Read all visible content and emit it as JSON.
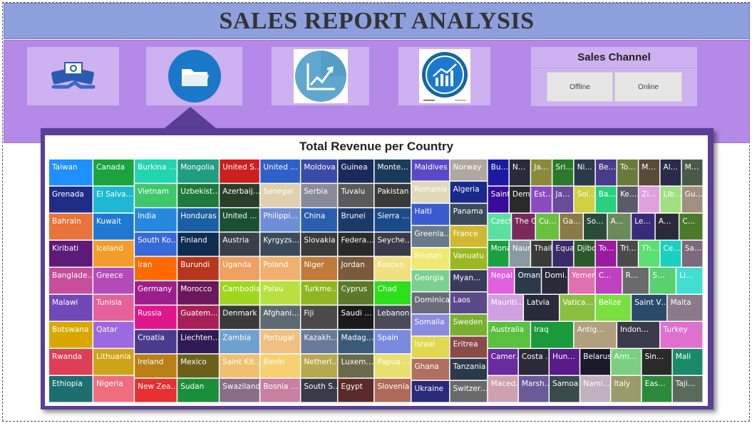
{
  "header": {
    "title": "SALES REPORT ANALYSIS"
  },
  "nav": {
    "tiles": [
      {
        "icon": "handshake-money-icon"
      },
      {
        "icon": "folder-icon"
      },
      {
        "icon": "line-chart-icon"
      },
      {
        "icon": "bar-trend-chart-icon"
      }
    ],
    "selected_index": 1
  },
  "sales_channel": {
    "title": "Sales Channel",
    "options": [
      "Offline",
      "Online"
    ]
  },
  "colors": {
    "title_bar": "#8e9fdd",
    "nav_band": "#b589e8",
    "tile": "#ceb1f0",
    "chart_frame": "#5b3f96"
  },
  "chart_data": {
    "type": "treemap",
    "title": "Total Revenue per Country",
    "columns": [
      {
        "weight": 62,
        "cells": [
          [
            "Taiwan",
            "#1e90ff"
          ],
          [
            "Grenada",
            "#1f2d86"
          ],
          [
            "Bahrain",
            "#e8743b"
          ],
          [
            "Kiribati",
            "#5e1a7a"
          ],
          [
            "Banglade…",
            "#c64e9a"
          ],
          [
            "Malawi",
            "#7048b8"
          ],
          [
            "Botswana",
            "#d9a800"
          ],
          [
            "Rwanda",
            "#dd3f56"
          ],
          [
            "Ethiopia",
            "#1c6f6f"
          ]
        ]
      },
      {
        "weight": 58,
        "cells": [
          [
            "Canada",
            "#1aa33f"
          ],
          [
            "El Salva…",
            "#1fb8d3"
          ],
          [
            "Kuwait",
            "#1f78d1"
          ],
          [
            "Iceland",
            "#f39c2a"
          ],
          [
            "Greece",
            "#b44cb8"
          ],
          [
            "Tunisia",
            "#e6609a"
          ],
          [
            "Qatar",
            "#9b69e0"
          ],
          [
            "Lithuania",
            "#cfa318"
          ],
          [
            "Nigeria",
            "#f06d7e"
          ]
        ]
      },
      {
        "weight": 60,
        "cells": [
          [
            "Burkina …",
            "#23d4b0"
          ],
          [
            "Vietnam",
            "#3fc86b"
          ],
          [
            "India",
            "#2687e0"
          ],
          [
            "South Ko…",
            "#3869d8"
          ],
          [
            "Iran",
            "#ff6a00"
          ],
          [
            "Germany",
            "#9c1e8a"
          ],
          [
            "Russia",
            "#e0168a"
          ],
          [
            "Croatia",
            "#4b3a8e"
          ],
          [
            "Ireland",
            "#b77f15"
          ],
          [
            "New Zea…",
            "#e83030"
          ]
        ]
      },
      {
        "weight": 59,
        "cells": [
          [
            "Mongolia",
            "#1f9e82"
          ],
          [
            "Uzbekist…",
            "#1e7a3a"
          ],
          [
            "Honduras",
            "#1a5fa3"
          ],
          [
            "Finland",
            "#0e2c4f"
          ],
          [
            "Burundi",
            "#b7361b"
          ],
          [
            "Morocco",
            "#6a1859"
          ],
          [
            "Guatem…",
            "#a81e57"
          ],
          [
            "Liechten…",
            "#2e1a55"
          ],
          [
            "Mexico",
            "#6b5f1a"
          ],
          [
            "Sudan",
            "#1a8f3a"
          ]
        ]
      },
      {
        "weight": 57,
        "cells": [
          [
            "United S…",
            "#cc1f1f"
          ],
          [
            "Azerbaij…",
            "#2a3f2a"
          ],
          [
            "United …",
            "#1a5030"
          ],
          [
            "Austria",
            "#3a3f4a"
          ],
          [
            "Uganda",
            "#f0a060"
          ],
          [
            "Cambodia",
            "#9fd61f"
          ],
          [
            "Denmark",
            "#3a3a3a"
          ],
          [
            "Zambia",
            "#6fa0d0"
          ],
          [
            "Saint Kit…",
            "#f0c070"
          ],
          [
            "Swaziland",
            "#8a6e88"
          ]
        ]
      },
      {
        "weight": 57,
        "cells": [
          [
            "United …",
            "#2f5fc8"
          ],
          [
            "Senegal",
            "#e0d0b0"
          ],
          [
            "Philippi…",
            "#6f8ed8"
          ],
          [
            "Kyrgyzs…",
            "#3a4a5a"
          ],
          [
            "Poland",
            "#f0b070"
          ],
          [
            "Palau",
            "#b8e040"
          ],
          [
            "Afghani…",
            "#5a6a70"
          ],
          [
            "Portugal",
            "#f0c080"
          ],
          [
            "Benin",
            "#f7d070"
          ],
          [
            "Bosnia …",
            "#c87fa0"
          ]
        ]
      },
      {
        "weight": 52,
        "cells": [
          [
            "Moldova",
            "#3a4aa8"
          ],
          [
            "Serbia",
            "#8a8a9a"
          ],
          [
            "China",
            "#2a5fb0"
          ],
          [
            "Slovakia",
            "#3a3a3a"
          ],
          [
            "Niger",
            "#c07a3a"
          ],
          [
            "Turkme…",
            "#8fb820"
          ],
          [
            "Fiji",
            "#4a4a4a"
          ],
          [
            "Kazakh…",
            "#6a7a9a"
          ],
          [
            "Netherl…",
            "#b8a850"
          ],
          [
            "South S…",
            "#3a3a4a"
          ]
        ]
      },
      {
        "weight": 51,
        "cells": [
          [
            "Guinea",
            "#1a2a5a"
          ],
          [
            "Tuvalu",
            "#5a5a5a"
          ],
          [
            "Brunei",
            "#1a3a6a"
          ],
          [
            "Federa…",
            "#2a2a2a"
          ],
          [
            "Jordan",
            "#7a5a3a"
          ],
          [
            "Cyprus",
            "#5a7a2a"
          ],
          [
            "Saudi …",
            "#1a1a1a"
          ],
          [
            "Madag…",
            "#3a5a7a"
          ],
          [
            "Luxem…",
            "#6a6a4a"
          ],
          [
            "Egypt",
            "#5a2a2a"
          ]
        ]
      },
      {
        "weight": 52,
        "cells": [
          [
            "Monte…",
            "#1a3a5a"
          ],
          [
            "Pakistan",
            "#3a3a3a"
          ],
          [
            "Sierra …",
            "#1a4a8a"
          ],
          [
            "Seyche…",
            "#3a3a4a"
          ],
          [
            "Kosovo",
            "#f0e080"
          ],
          [
            "Chad",
            "#2ee01a"
          ],
          [
            "Lebanon",
            "#4a4a5a"
          ],
          [
            "Spain",
            "#7a8ae0"
          ],
          [
            "Papua …",
            "#e8e070"
          ],
          [
            "Slovenia",
            "#b06a5a"
          ]
        ]
      },
      {
        "weight": 54,
        "cells": [
          [
            "Maldives",
            "#5a48c8"
          ],
          [
            "Romania",
            "#e0d8b8"
          ],
          [
            "Haiti",
            "#3a5ad0"
          ],
          [
            "Greenla…",
            "#6a7a8a"
          ],
          [
            "Bhutan",
            "#f0e870"
          ],
          [
            "Georgia",
            "#7ad090"
          ],
          [
            "Dominica",
            "#6a6a7a"
          ],
          [
            "Somalia",
            "#8a8ae0"
          ],
          [
            "Israel",
            "#e0d850"
          ],
          [
            "Ghana",
            "#b07060"
          ],
          [
            "Ukraine",
            "#2a2a7a"
          ]
        ]
      },
      {
        "weight": 53,
        "cells": [
          [
            "Norway",
            "#b0a8a0"
          ],
          [
            "Algeria",
            "#1a2a8a"
          ],
          [
            "Panama",
            "#3a4a5a"
          ],
          [
            "France",
            "#d0b830"
          ],
          [
            "Vanuatu",
            "#9ab820"
          ],
          [
            "Myan…",
            "#3a3a5a"
          ],
          [
            "Laos",
            "#5a4a8a"
          ],
          [
            "Sweden",
            "#7ab030"
          ],
          [
            "Eritrea",
            "#8a4a4a"
          ],
          [
            "Tanzania",
            "#2a3a4a"
          ],
          [
            "Switzer…",
            "#6a6a6a"
          ]
        ]
      },
      {
        "weight": 302,
        "cells": []
      }
    ],
    "rest": [
      [
        "Bu…",
        "#1a1aa0"
      ],
      [
        "N…",
        "#2a2a3a"
      ],
      [
        "Ja…",
        "#8a8a3a"
      ],
      [
        "Sri…",
        "#2a7a2a"
      ],
      [
        "Ni…",
        "#2a3a4a"
      ],
      [
        "Be…",
        "#4a3a8a"
      ],
      [
        "To…",
        "#6a7a3a"
      ],
      [
        "M…",
        "#5a4a3a"
      ],
      [
        "Al…",
        "#2a2a4a"
      ],
      [
        "M…",
        "#4a5a4a"
      ],
      [
        "Saint L…",
        "#3a0a9a"
      ],
      [
        "Democ…",
        "#2a2a2a"
      ],
      [
        "Est…",
        "#8a4ac0"
      ],
      [
        "Ja…",
        "#6a4a9a"
      ],
      [
        "Sol…",
        "#d0d040"
      ],
      [
        "Ba…",
        "#2ad080"
      ],
      [
        "Ke…",
        "#5a5a6a"
      ],
      [
        "Zi…",
        "#e0a0e0"
      ],
      [
        "Lib…",
        "#a0e080"
      ],
      [
        "Gu…",
        "#a09080"
      ],
      [
        "Czech …",
        "#5ae0a0"
      ],
      [
        "The G…",
        "#7a2a5a"
      ],
      [
        "Cu…",
        "#6ac040"
      ],
      [
        "Ga…",
        "#8a7a4a"
      ],
      [
        "So…",
        "#2a4a3a"
      ],
      [
        "A…",
        "#6a8a5a"
      ],
      [
        "Le…",
        "#3a2a7a"
      ],
      [
        "A…",
        "#2a2a3a"
      ],
      [
        "C…",
        "#4a7a2a"
      ],
      [
        "Monaco",
        "#1aa040"
      ],
      [
        "Nauru",
        "#8a9aa0"
      ],
      [
        "Thailand",
        "#3a3a3a"
      ],
      [
        "Equat…",
        "#3a2a6a"
      ],
      [
        "Djibouti",
        "#2a5a2a"
      ],
      [
        "To…",
        "#9a1aa0"
      ],
      [
        "Tri…",
        "#4a4a4a"
      ],
      [
        "Th…",
        "#5ae070"
      ],
      [
        "Ce…",
        "#1ad0c0"
      ],
      [
        "Sa…",
        "#7a6a7a"
      ],
      [
        "Nepal",
        "#e060e0"
      ],
      [
        "Oman",
        "#2a3a4a"
      ],
      [
        "Domi…",
        "#2a2a3a"
      ],
      [
        "Yemen",
        "#e070b0"
      ],
      [
        "C…",
        "#c040c0"
      ],
      [
        "R…",
        "#6a6a6a"
      ],
      [
        "S…",
        "#5ad070"
      ],
      [
        "Li…",
        "#40e0d0"
      ],
      [
        "Mauriti…",
        "#d0a0e0"
      ],
      [
        "Latvia",
        "#2a2a3a"
      ],
      [
        "Vatica…",
        "#8ac040"
      ],
      [
        "Belize",
        "#7ae040"
      ],
      [
        "Saint V…",
        "#2a4a6a"
      ],
      [
        "Malta",
        "#8a7a8a"
      ],
      [
        "Australia",
        "#5ac040"
      ],
      [
        "Iraq",
        "#1a9a3a"
      ],
      [
        "Antig…",
        "#b0a080"
      ],
      [
        "Indon…",
        "#3a3a4a"
      ],
      [
        "Turkey",
        "#e070d0"
      ],
      [
        "Camer…",
        "#6a2aa0"
      ],
      [
        "Costa …",
        "#2a2a3a"
      ],
      [
        "Hun…",
        "#5a1a8a"
      ],
      [
        "Belarus",
        "#1a1a2a"
      ],
      [
        "Arm…",
        "#7ad080"
      ],
      [
        "Sin…",
        "#2a2a2a"
      ],
      [
        "Mali",
        "#1a8a6a"
      ],
      [
        "Maced…",
        "#d0a0b0"
      ],
      [
        "Marsh…",
        "#6a5a9a"
      ],
      [
        "Samoa",
        "#3a4a4a"
      ],
      [
        "Nami…",
        "#c0b0c0"
      ],
      [
        "Italy",
        "#9a9a6a"
      ],
      [
        "Eas…",
        "#2a8a3a"
      ],
      [
        "Taji…",
        "#5a6a5a"
      ]
    ]
  }
}
